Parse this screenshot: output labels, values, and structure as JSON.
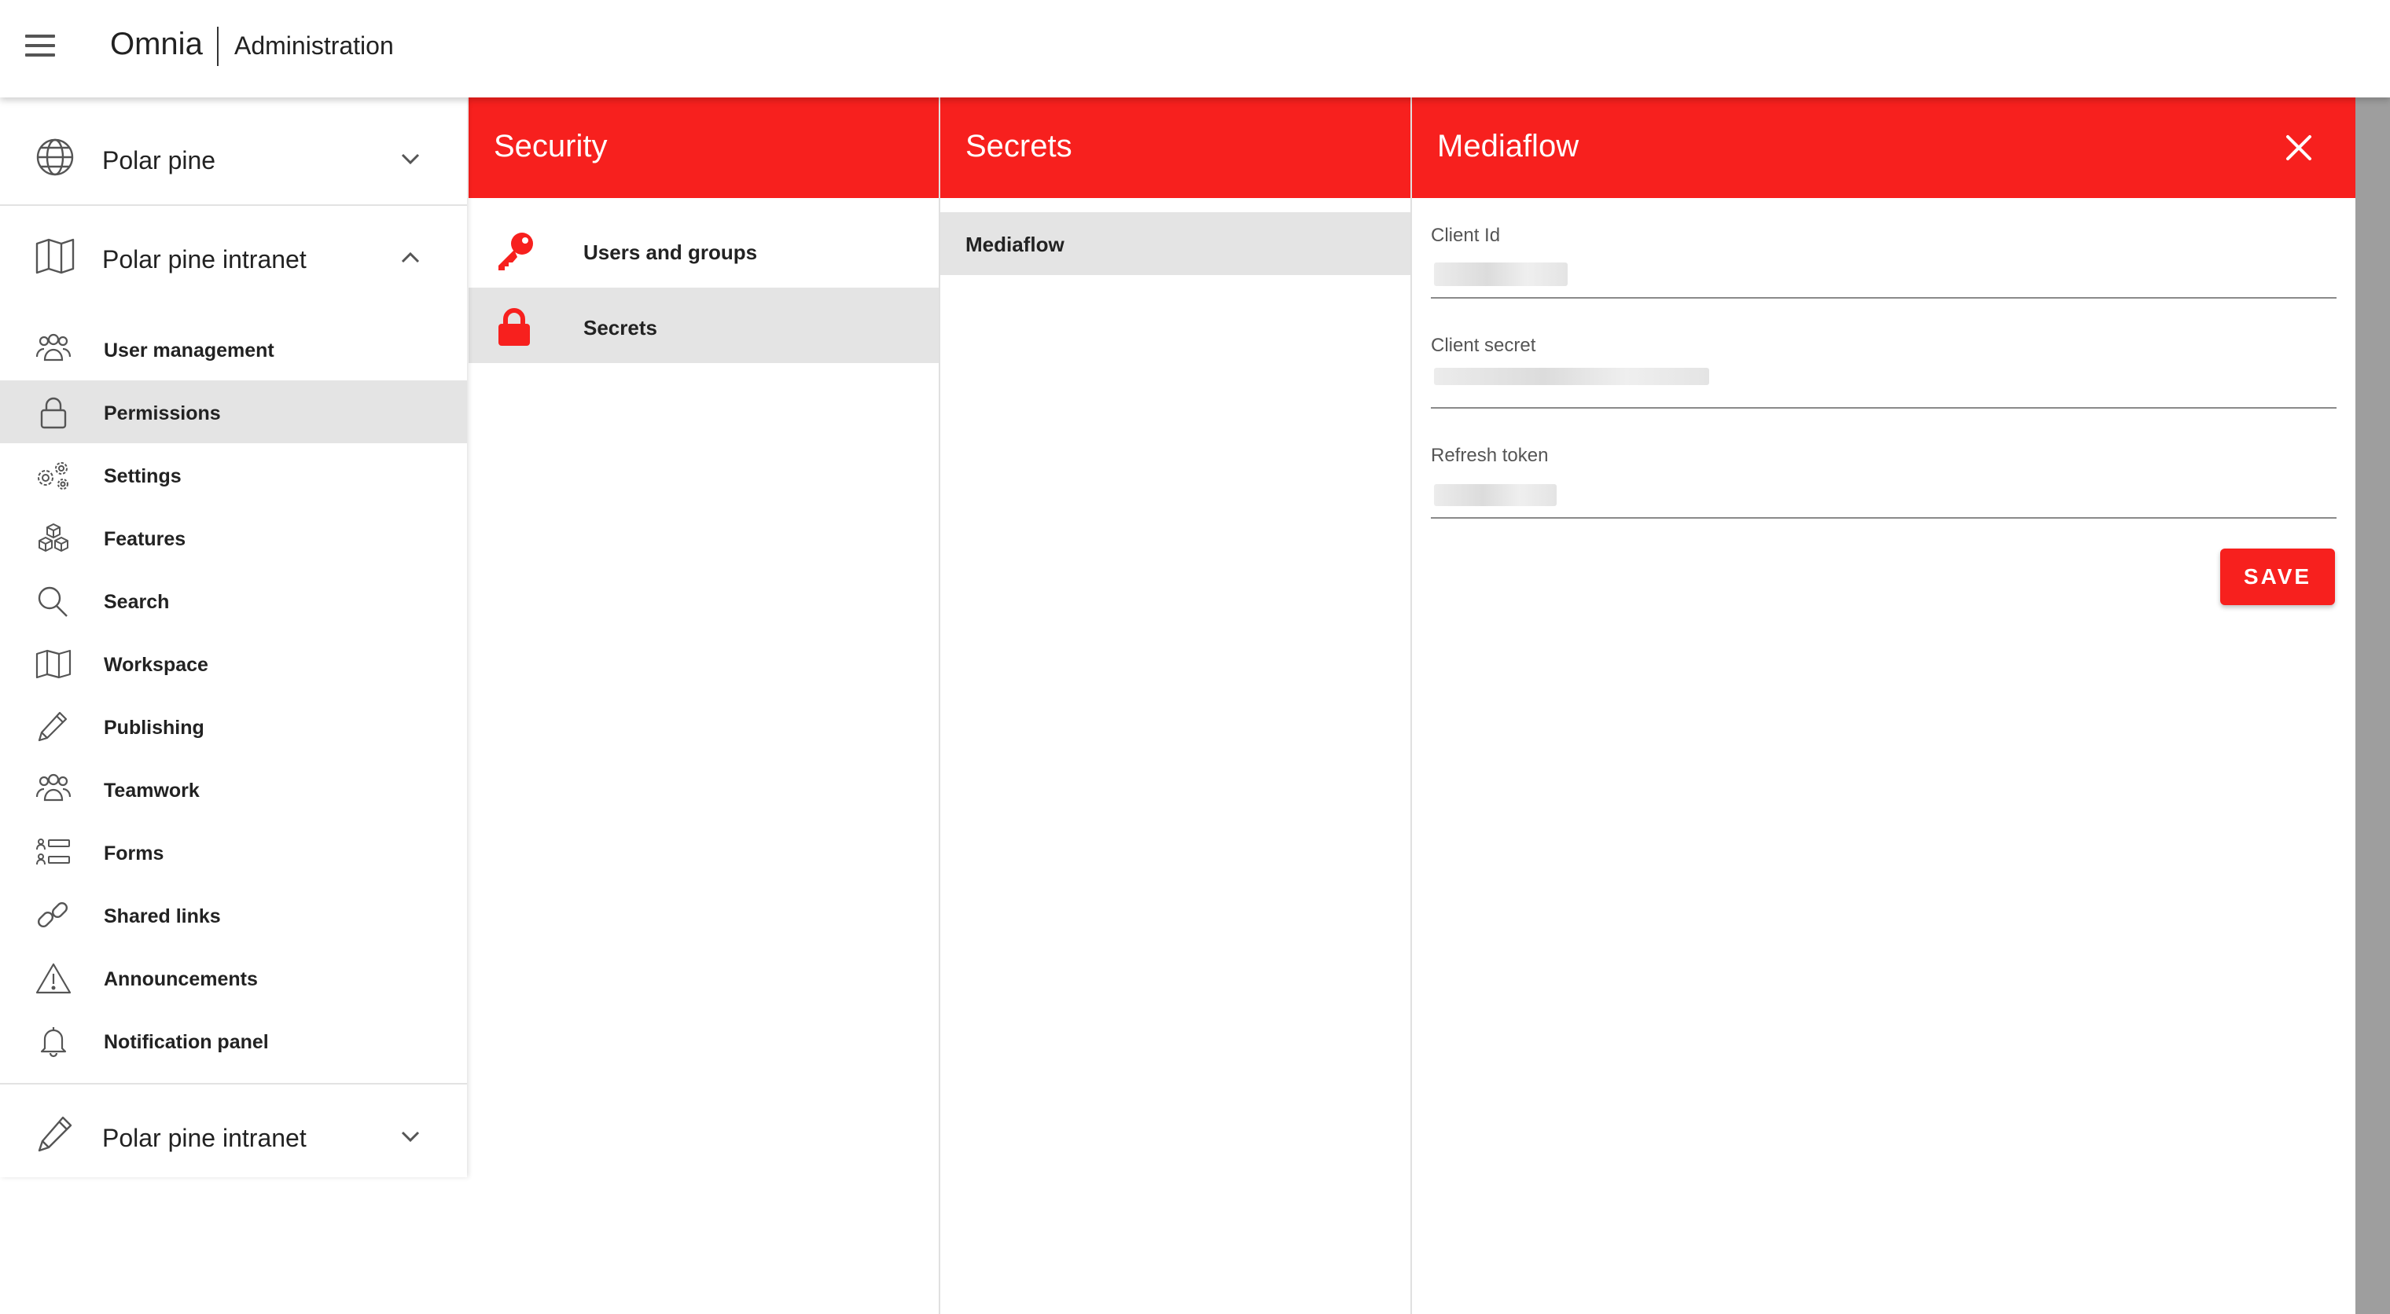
{
  "header": {
    "brand": "Omnia",
    "section": "Administration"
  },
  "sidebar": {
    "tenant_top": {
      "label": "Polar pine",
      "icon": "globe-icon"
    },
    "tenant_expanded": {
      "label": "Polar pine intranet",
      "icon": "map-icon"
    },
    "items": [
      {
        "label": "User management",
        "icon": "users-icon"
      },
      {
        "label": "Permissions",
        "icon": "lock-icon",
        "active": true
      },
      {
        "label": "Settings",
        "icon": "settings-icon"
      },
      {
        "label": "Features",
        "icon": "features-icon"
      },
      {
        "label": "Search",
        "icon": "search-icon"
      },
      {
        "label": "Workspace",
        "icon": "map-icon"
      },
      {
        "label": "Publishing",
        "icon": "pencil-icon"
      },
      {
        "label": "Teamwork",
        "icon": "users-icon"
      },
      {
        "label": "Forms",
        "icon": "forms-icon"
      },
      {
        "label": "Shared links",
        "icon": "link-icon"
      },
      {
        "label": "Announcements",
        "icon": "warning-icon"
      },
      {
        "label": "Notification panel",
        "icon": "bell-icon"
      }
    ],
    "tenant_bottom": {
      "label": "Polar pine intranet",
      "icon": "pencil-icon"
    }
  },
  "security_panel": {
    "title": "Security",
    "items": [
      {
        "label": "Users and groups",
        "icon": "key-icon"
      },
      {
        "label": "Secrets",
        "icon": "lock-icon",
        "active": true
      }
    ]
  },
  "secrets_panel": {
    "title": "Secrets",
    "items": [
      {
        "label": "Mediaflow",
        "active": true
      }
    ]
  },
  "detail_panel": {
    "title": "Mediaflow",
    "fields": {
      "client_id": {
        "label": "Client Id"
      },
      "client_secret": {
        "label": "Client secret"
      },
      "refresh_token": {
        "label": "Refresh token"
      }
    },
    "save_label": "SAVE"
  },
  "colors": {
    "accent": "#f7201e",
    "active_row": "#e4e4e4"
  }
}
